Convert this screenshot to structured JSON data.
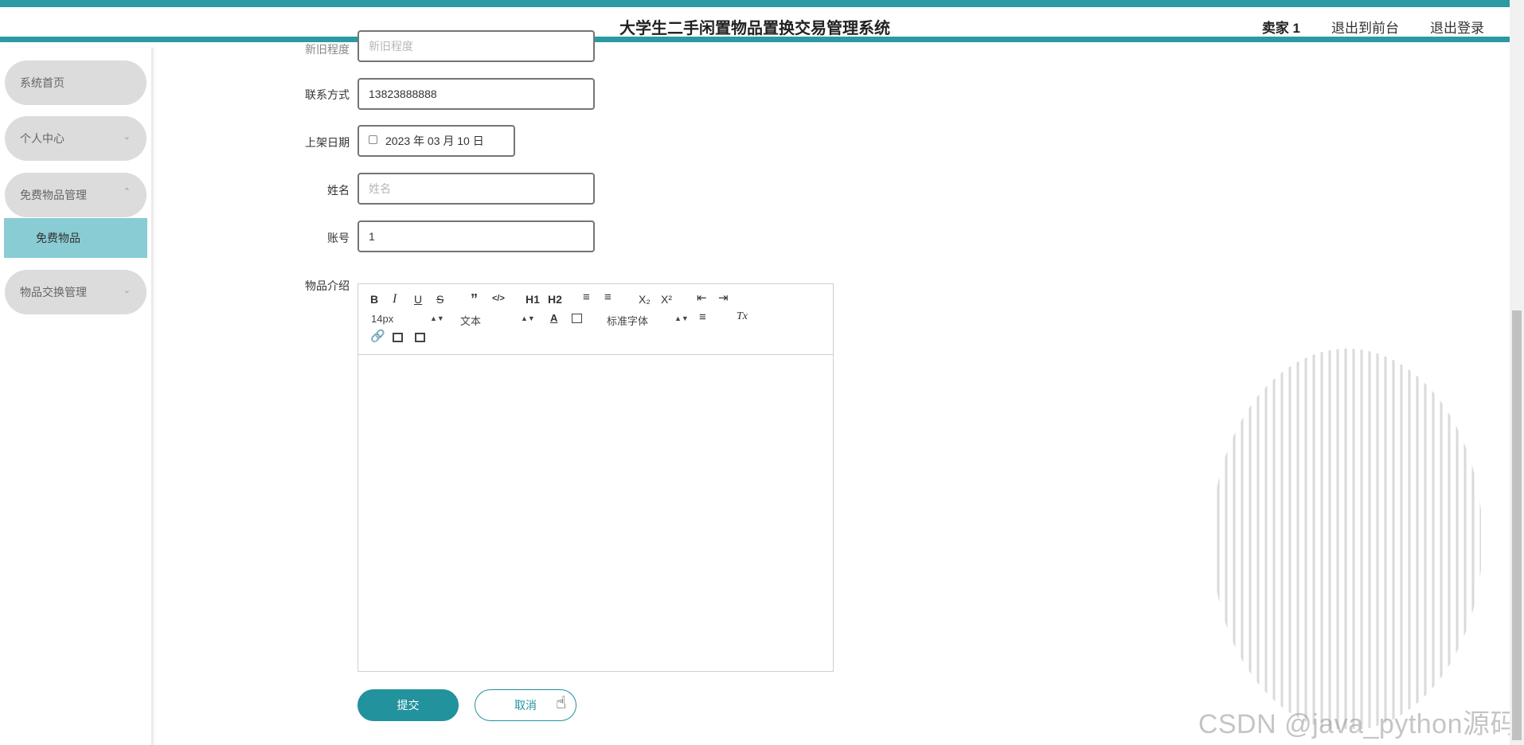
{
  "header": {
    "title": "大学生二手闲置物品置换交易管理系统",
    "user": "卖家 1",
    "to_front": "退出到前台",
    "logout": "退出登录"
  },
  "sidebar": {
    "items": [
      {
        "label": "系统首页"
      },
      {
        "label": "个人中心"
      },
      {
        "label": "免费物品管理"
      },
      {
        "label": "免费物品"
      },
      {
        "label": "物品交换管理"
      }
    ]
  },
  "form": {
    "cut_label": "新旧程度",
    "cut_placeholder": "新旧程度",
    "contact_label": "联系方式",
    "contact_value": "13823888888",
    "date_label": "上架日期",
    "date_value": "2023 年 03 月 10 日",
    "name_label": "姓名",
    "name_placeholder": "姓名",
    "account_label": "账号",
    "account_value": "1",
    "intro_label": "物品介绍"
  },
  "editor": {
    "bold": "B",
    "italic": "I",
    "underline": "U",
    "strike": "S",
    "quote": "”",
    "code": "</>",
    "h1": "H1",
    "h2": "H2",
    "sub": "X₂",
    "sup": "X²",
    "font_size": "14px",
    "text_style": "文本",
    "font_family": "标准字体",
    "clear": "Tx"
  },
  "buttons": {
    "submit": "提交",
    "cancel": "取消"
  },
  "watermark": "CSDN @java_python源码",
  "colors": {
    "accent": "#2b9aa3",
    "submenu_active": "#89ccd3",
    "menu_bg": "#dcdcdc"
  }
}
